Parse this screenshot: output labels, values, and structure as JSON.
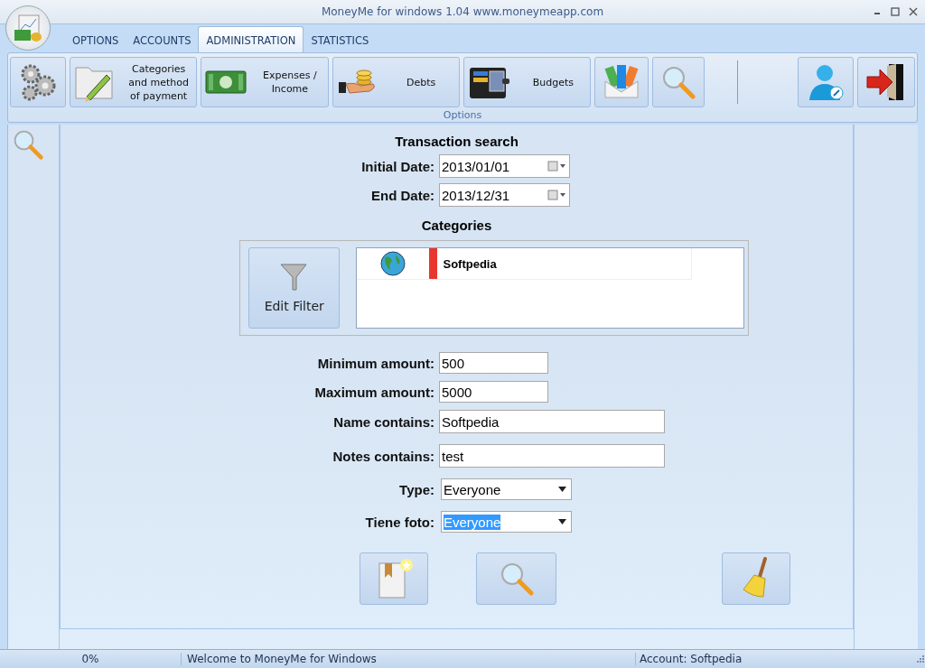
{
  "window": {
    "title": "MoneyMe for windows 1.04 www.moneymeapp.com"
  },
  "tabs": [
    {
      "label": "OPTIONS",
      "selected": false
    },
    {
      "label": "ACCOUNTS",
      "selected": false
    },
    {
      "label": "ADMINISTRATION",
      "selected": true
    },
    {
      "label": "STATISTICS",
      "selected": false
    }
  ],
  "ribbon": {
    "buttons": [
      {
        "kind": "gears"
      },
      {
        "kind": "folder",
        "label": "Categories and method of payment"
      },
      {
        "kind": "money",
        "label": "Expenses / Income"
      },
      {
        "kind": "coins",
        "label": "Debts"
      },
      {
        "kind": "wallet",
        "label": "Budgets"
      },
      {
        "kind": "envelope"
      },
      {
        "kind": "search"
      },
      {
        "kind": "separator"
      },
      {
        "kind": "user"
      },
      {
        "kind": "exit"
      }
    ],
    "group_label": "Options"
  },
  "form": {
    "title": "Transaction search",
    "dates": [
      {
        "label": "Initial Date:",
        "value": "2013/01/01"
      },
      {
        "label": "End Date:",
        "value": "2013/12/31"
      }
    ],
    "categories_title": "Categories",
    "edit_filter": "Edit Filter",
    "categories": [
      {
        "name": "Softpedia",
        "color": "#e8362f"
      }
    ],
    "amounts": [
      {
        "label": "Minimum amount:",
        "value": "500"
      },
      {
        "label": "Maximum amount:",
        "value": "5000"
      }
    ],
    "texts": [
      {
        "label": "Name contains:",
        "value": "Softpedia"
      },
      {
        "label": "Notes contains:",
        "value": "test"
      }
    ],
    "selects": [
      {
        "label": "Type:",
        "value": "Everyone",
        "highlighted": false
      },
      {
        "label": "Tiene foto:",
        "value": "Everyone",
        "highlighted": true
      }
    ],
    "actions": [
      {
        "kind": "bookmark"
      },
      {
        "kind": "search"
      },
      {
        "kind": "broom"
      }
    ]
  },
  "status_bar": {
    "progress": "0%",
    "message": "Welcome to MoneyMe for Windows",
    "account": "Account: Softpedia"
  }
}
